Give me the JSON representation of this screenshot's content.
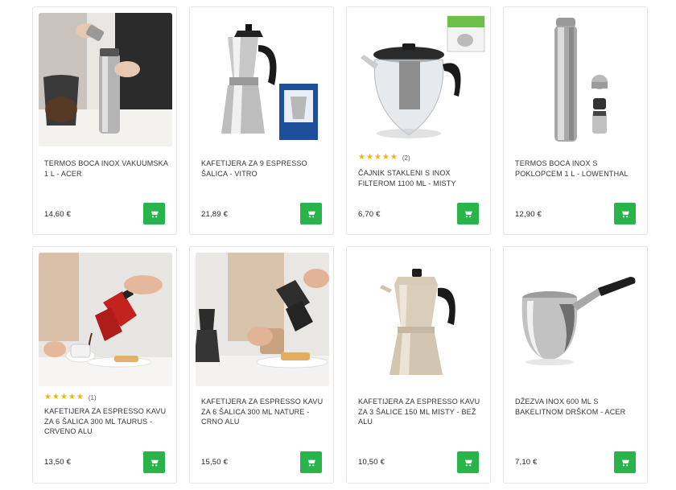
{
  "products": [
    {
      "title": "TERMOS BOCA INOX VAKUUMSKA 1 L - ACER",
      "price": "14,60 €",
      "image": "thermos-pouring-photo",
      "rating": null
    },
    {
      "title": "KAFETIJERA ZA 9 ESPRESSO ŠALICA - VITRO",
      "price": "21,89 €",
      "image": "moka-pot-with-box",
      "rating": null
    },
    {
      "title": "ČAJNIK STAKLENI S INOX FILTEROM 1100 mL - MISTY",
      "price": "6,70 €",
      "image": "glass-teapot",
      "rating": {
        "stars": 5,
        "count": "(2)"
      }
    },
    {
      "title": "TERMOS BOCA INOX S POKLOPCEM 1 L - LOWENTHAL",
      "price": "12,90 €",
      "image": "steel-thermos",
      "rating": null
    },
    {
      "title": "KAFETIJERA ZA ESPRESSO KAVU ZA 6 ŠALICA 300 mL TAURUS - CRVENO ALU",
      "price": "13,50 €",
      "image": "red-moka-pot-pouring",
      "rating": {
        "stars": 5,
        "count": "(1)"
      }
    },
    {
      "title": "KAFETIJERA ZA ESPRESSO KAVU ZA 6 ŠALICA 300 mL NATURE - CRNO ALU",
      "price": "15,50 €",
      "image": "black-moka-pot-pouring",
      "rating": null
    },
    {
      "title": "KAFETIJERA ZA ESPRESSO KAVU ZA 3 ŠALICE 150 mL MISTY - BEŽ ALU",
      "price": "10,50 €",
      "image": "beige-moka-pot",
      "rating": null
    },
    {
      "title": "DŽEZVA INOX 600 ML S BAKELITNOM DRŠKOM - ACER",
      "price": "7,10 €",
      "image": "inox-cezve",
      "rating": null
    }
  ],
  "colors": {
    "cart_button": "#28b44b",
    "star": "#f5b301",
    "border": "#e4e4e4"
  },
  "icons": {
    "cart": "shopping-cart-icon",
    "star": "star-icon"
  }
}
